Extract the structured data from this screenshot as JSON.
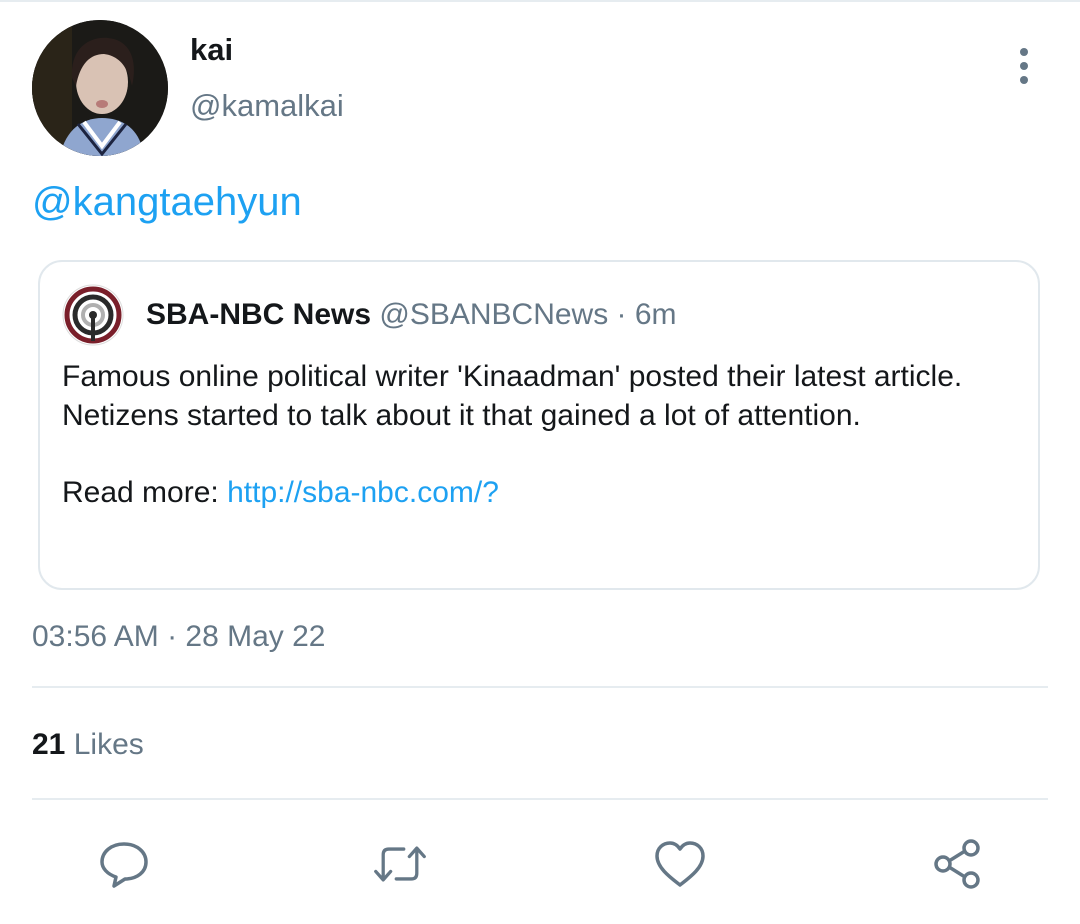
{
  "tweet": {
    "author_name": "kai",
    "author_handle": "@kamalkai",
    "text_mention": "@kangtaehyun",
    "timestamp": "03:56 AM · 28 May 22",
    "likes_count": "21",
    "likes_label": "Likes"
  },
  "quoted_tweet": {
    "name": "SBA-NBC News",
    "meta": "@SBANBCNews · 6m",
    "text": "Famous online political writer 'Kinaadman' posted their latest article. Netizens started to talk about it that gained a lot of attention.",
    "read_more_label": "Read more:",
    "link": "http://sba-nbc.com/?"
  },
  "icons": {
    "more": "more-vertical-icon",
    "reply": "reply-icon",
    "retweet": "retweet-icon",
    "like": "heart-icon",
    "share": "share-icon"
  },
  "colors": {
    "accent": "#1da1f2",
    "secondary_text": "#657786",
    "primary_text": "#14171a",
    "border": "#e1e8ed"
  }
}
